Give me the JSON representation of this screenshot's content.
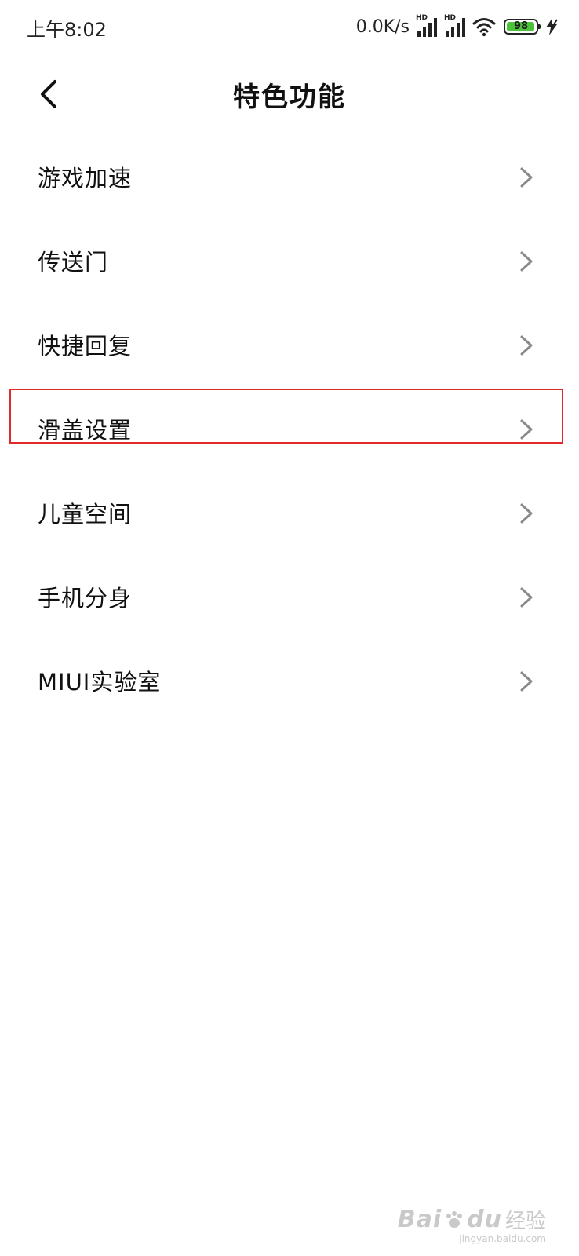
{
  "status_bar": {
    "time": "上午8:02",
    "net_speed": "0.0K/s",
    "signal_1_label": "HD",
    "signal_2_label": "HD",
    "wifi_icon": "wifi-icon",
    "battery_level": "98",
    "battery_fraction": 0.98,
    "charging_icon": "charging-bolt-icon"
  },
  "header": {
    "back_icon": "chevron-left-icon",
    "title": "特色功能"
  },
  "menu": {
    "items": [
      {
        "label": "游戏加速",
        "highlighted": false
      },
      {
        "label": "传送门",
        "highlighted": false
      },
      {
        "label": "快捷回复",
        "highlighted": false
      },
      {
        "label": "滑盖设置",
        "highlighted": true
      },
      {
        "label": "儿童空间",
        "highlighted": false
      },
      {
        "label": "手机分身",
        "highlighted": false
      },
      {
        "label": "MIUI实验室",
        "highlighted": false
      }
    ]
  },
  "watermark": {
    "brand": "Bai",
    "brand_suffix": "du",
    "product": "经验",
    "url": "jingyan.baidu.com"
  },
  "colors": {
    "highlight_border": "#e02a2a",
    "battery_fill": "#4cc13a",
    "chevron": "#8a8a8a"
  }
}
